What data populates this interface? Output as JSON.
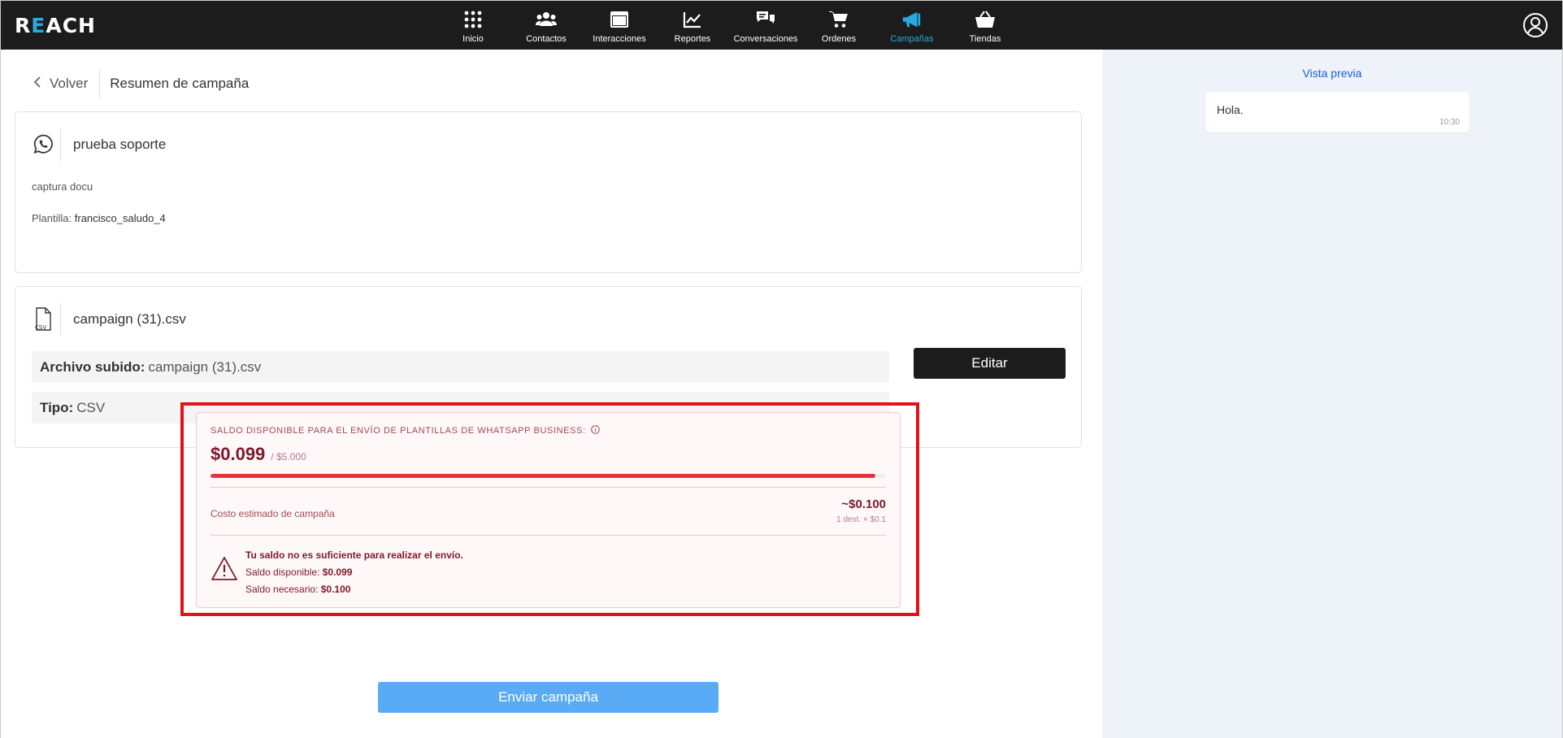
{
  "app": {
    "logo_pre": "R",
    "logo_accent": "E",
    "logo_post": "ACH"
  },
  "nav": {
    "items": [
      {
        "label": "Inicio",
        "icon": "grid-icon"
      },
      {
        "label": "Contactos",
        "icon": "people-icon"
      },
      {
        "label": "Interacciones",
        "icon": "window-icon"
      },
      {
        "label": "Reportes",
        "icon": "chart-line-icon"
      },
      {
        "label": "Conversaciones",
        "icon": "chat-bubbles-icon"
      },
      {
        "label": "Ordenes",
        "icon": "cart-icon"
      },
      {
        "label": "Campañas",
        "icon": "megaphone-icon",
        "active": true
      },
      {
        "label": "Tiendas",
        "icon": "basket-icon"
      }
    ],
    "accent_color": "#27a9e1"
  },
  "header": {
    "back_label": "Volver",
    "page_title": "Resumen de campaña"
  },
  "campaign": {
    "channel_icon": "whatsapp-icon",
    "name": "prueba soporte",
    "description": "captura docu",
    "template_label": "Plantilla:",
    "template_name": "francisco_saludo_4"
  },
  "file": {
    "icon": "csv-file-icon",
    "name": "campaign (31).csv",
    "uploaded_label": "Archivo subido:",
    "uploaded_value": "campaign (31).csv",
    "type_label": "Tipo:",
    "type_value": "CSV",
    "edit_label": "Editar"
  },
  "balance": {
    "title": "SALDO DISPONIBLE PARA EL ENVÍO DE PLANTILLAS DE WHATSAPP BUSINESS:",
    "available": "$0.099",
    "of_total": "/ $5.000",
    "progress_fraction": 0.984,
    "cost_label": "Costo estimado de campaña",
    "cost_value": "~$0.100",
    "cost_detail": "1 dest. × $0.1",
    "warning_title": "Tu saldo no es suficiente para realizar el envío.",
    "available_label": "Saldo disponible:",
    "available_value": "$0.099",
    "needed_label": "Saldo necesario:",
    "needed_value": "$0.100",
    "alert_color": "#e3121a"
  },
  "actions": {
    "send_label": "Enviar campaña"
  },
  "preview": {
    "title": "Vista previa",
    "message": "Hola.",
    "time": "10:30"
  }
}
